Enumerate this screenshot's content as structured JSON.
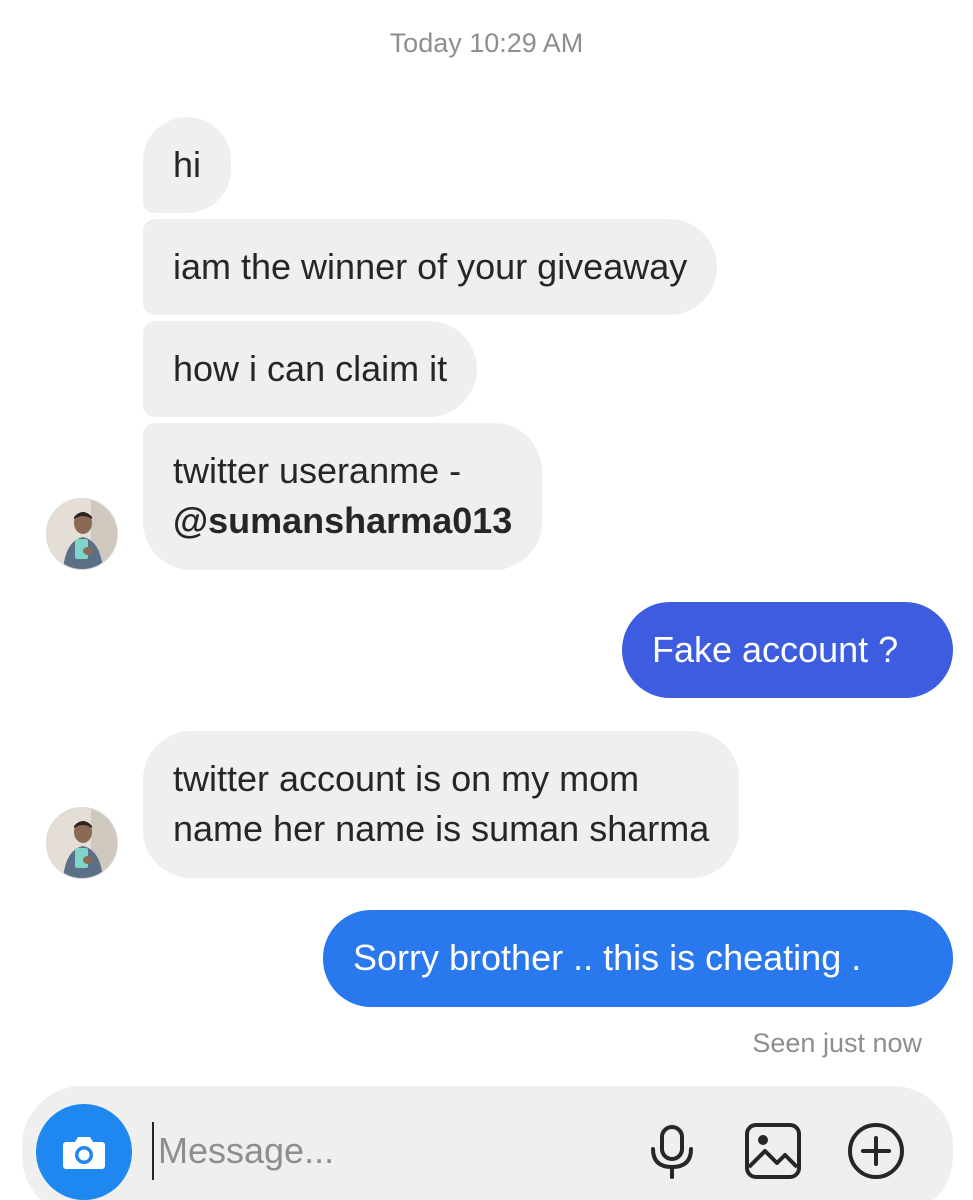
{
  "thread": {
    "timestamp": "Today 10:29 AM",
    "incoming_group_1": [
      "hi",
      "iam the winner of your giveaway",
      "how i can claim it"
    ],
    "incoming_username": {
      "line1": "twitter useranme -",
      "handle": "@sumansharma013"
    },
    "outgoing_1": "Fake account ?",
    "incoming_group_2": {
      "line1": "twitter account is on my mom",
      "line2": "name her name is suman sharma"
    },
    "outgoing_2": "Sorry brother .. this is cheating .",
    "seen_status": "Seen just now"
  },
  "composer": {
    "placeholder": "Message...",
    "camera_icon": "camera-icon",
    "mic_icon": "microphone-icon",
    "gallery_icon": "gallery-icon",
    "add_icon": "plus-circle-icon"
  },
  "colors": {
    "incoming_bubble": "#efefef",
    "outgoing_bubble_1": "#3d5ce0",
    "outgoing_bubble_2": "#2a78ee",
    "camera_button": "#1f87f0"
  }
}
